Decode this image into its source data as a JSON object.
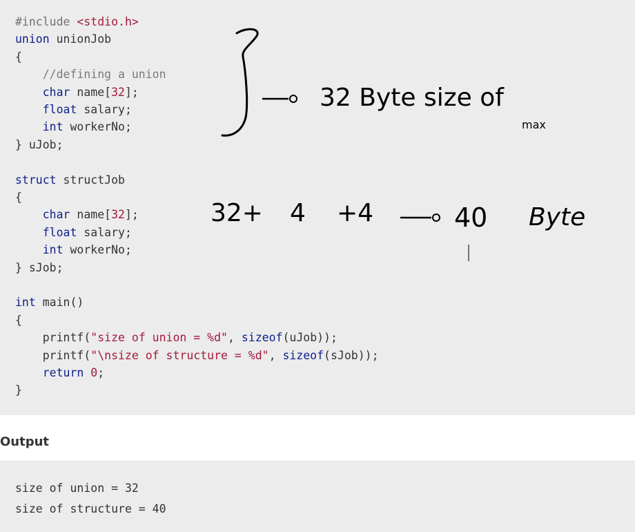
{
  "code": {
    "lines": [
      [
        {
          "t": "#include ",
          "c": "pre"
        },
        {
          "t": "<stdio.h>",
          "c": "str"
        }
      ],
      [
        {
          "t": "union",
          "c": "kw"
        },
        {
          "t": " unionJob",
          "c": "plain"
        }
      ],
      [
        {
          "t": "{",
          "c": "plain"
        }
      ],
      [
        {
          "t": "    //defining a union",
          "c": "com"
        }
      ],
      [
        {
          "t": "    ",
          "c": "plain"
        },
        {
          "t": "char",
          "c": "kw"
        },
        {
          "t": " name[",
          "c": "plain"
        },
        {
          "t": "32",
          "c": "num"
        },
        {
          "t": "];",
          "c": "plain"
        }
      ],
      [
        {
          "t": "    ",
          "c": "plain"
        },
        {
          "t": "float",
          "c": "kw"
        },
        {
          "t": " salary;",
          "c": "plain"
        }
      ],
      [
        {
          "t": "    ",
          "c": "plain"
        },
        {
          "t": "int",
          "c": "kw"
        },
        {
          "t": " workerNo;",
          "c": "plain"
        }
      ],
      [
        {
          "t": "} uJob;",
          "c": "plain"
        }
      ],
      [],
      [
        {
          "t": "struct",
          "c": "kw"
        },
        {
          "t": " structJob",
          "c": "plain"
        }
      ],
      [
        {
          "t": "{",
          "c": "plain"
        }
      ],
      [
        {
          "t": "    ",
          "c": "plain"
        },
        {
          "t": "char",
          "c": "kw"
        },
        {
          "t": " name[",
          "c": "plain"
        },
        {
          "t": "32",
          "c": "num"
        },
        {
          "t": "];",
          "c": "plain"
        }
      ],
      [
        {
          "t": "    ",
          "c": "plain"
        },
        {
          "t": "float",
          "c": "kw"
        },
        {
          "t": " salary;",
          "c": "plain"
        }
      ],
      [
        {
          "t": "    ",
          "c": "plain"
        },
        {
          "t": "int",
          "c": "kw"
        },
        {
          "t": " workerNo;",
          "c": "plain"
        }
      ],
      [
        {
          "t": "} sJob;",
          "c": "plain"
        }
      ],
      [],
      [
        {
          "t": "int",
          "c": "kw"
        },
        {
          "t": " main()",
          "c": "plain"
        }
      ],
      [
        {
          "t": "{",
          "c": "plain"
        }
      ],
      [
        {
          "t": "    printf(",
          "c": "plain"
        },
        {
          "t": "\"size of union = %d\"",
          "c": "str"
        },
        {
          "t": ", ",
          "c": "plain"
        },
        {
          "t": "sizeof",
          "c": "kw"
        },
        {
          "t": "(uJob));",
          "c": "plain"
        }
      ],
      [
        {
          "t": "    printf(",
          "c": "plain"
        },
        {
          "t": "\"\\nsize of structure = %d\"",
          "c": "str"
        },
        {
          "t": ", ",
          "c": "plain"
        },
        {
          "t": "sizeof",
          "c": "kw"
        },
        {
          "t": "(sJob));",
          "c": "plain"
        }
      ],
      [
        {
          "t": "    ",
          "c": "plain"
        },
        {
          "t": "return",
          "c": "kw"
        },
        {
          "t": " ",
          "c": "plain"
        },
        {
          "t": "0",
          "c": "num"
        },
        {
          "t": ";",
          "c": "plain"
        }
      ],
      [
        {
          "t": "}",
          "c": "plain"
        }
      ]
    ]
  },
  "annotations": {
    "union_note": "32 Byte size of",
    "union_note_sub": "max",
    "struct_note_32": "32+",
    "struct_note_4a": "4",
    "struct_note_4b": "+4",
    "struct_note_result": "40",
    "struct_note_byte": "Byte"
  },
  "output": {
    "heading": "Output",
    "lines": [
      "size of union = 32",
      "size of structure = 40"
    ]
  }
}
